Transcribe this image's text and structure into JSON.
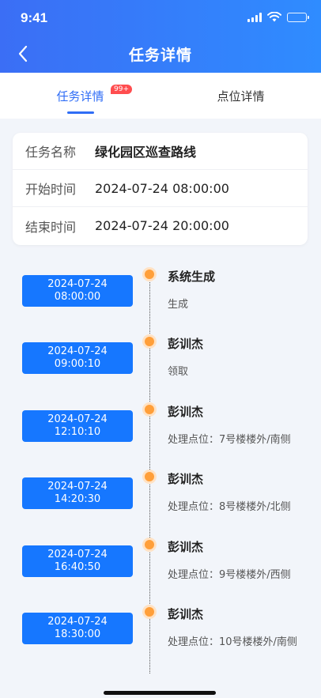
{
  "status_bar": {
    "time": "9:41"
  },
  "nav": {
    "title": "任务详情"
  },
  "tabs": [
    {
      "label": "任务详情",
      "badge": "99+",
      "active": true
    },
    {
      "label": "点位详情",
      "active": false
    }
  ],
  "info": {
    "rows": [
      {
        "label": "任务名称",
        "value": "绿化园区巡查路线"
      },
      {
        "label": "开始时间",
        "value": "2024-07-24 08:00:00"
      },
      {
        "label": "结束时间",
        "value": "2024-07-24 20:00:00"
      }
    ]
  },
  "timeline": [
    {
      "date": "2024-07-24",
      "time": "08:00:00",
      "name": "系统生成",
      "desc": "生成"
    },
    {
      "date": "2024-07-24",
      "time": "09:00:10",
      "name": "彭训杰",
      "desc": "领取"
    },
    {
      "date": "2024-07-24",
      "time": "12:10:10",
      "name": "彭训杰",
      "desc": "处理点位：7号楼楼外/南侧"
    },
    {
      "date": "2024-07-24",
      "time": "14:20:30",
      "name": "彭训杰",
      "desc": "处理点位：8号楼楼外/北侧"
    },
    {
      "date": "2024-07-24",
      "time": "16:40:50",
      "name": "彭训杰",
      "desc": "处理点位：9号楼楼外/西侧"
    },
    {
      "date": "2024-07-24",
      "time": "18:30:00",
      "name": "彭训杰",
      "desc": "处理点位：10号楼楼外/南侧"
    }
  ],
  "colors": {
    "accent": "#2f6df6",
    "time_chip": "#1677ff",
    "dot": "#ff9f3a",
    "badge": "#ff4d4f"
  }
}
